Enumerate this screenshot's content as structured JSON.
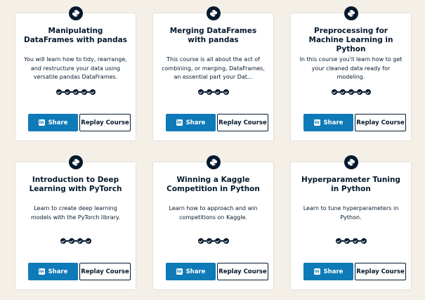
{
  "buttons": {
    "share_label": "Share",
    "replay_label": "Replay Course",
    "linkedin_glyph": "in"
  },
  "colors": {
    "background": "#f4f0e8",
    "ink": "#05192d",
    "share_blue": "#0f7ab8"
  },
  "courses": [
    {
      "title": "Manipulating DataFrames with pandas",
      "description": "You will learn how to tidy, rearrange, and restructure your data using versatile pandas DataFrames.",
      "chapters": 5
    },
    {
      "title": "Merging DataFrames with pandas",
      "description": "This course is all about the act of combining, or merging, DataFrames, an essential part your Dat...",
      "chapters": 4
    },
    {
      "title": "Preprocessing for Machine Learning in Python",
      "description": "In this course you'll learn how to get your cleaned data ready for modeling.",
      "chapters": 5
    },
    {
      "title": "Introduction to Deep Learning with PyTorch",
      "description": "Learn to create deep learning models with the PyTorch library.",
      "chapters": 4
    },
    {
      "title": "Winning a Kaggle Competition in Python",
      "description": "Learn how to approach and win competitions on Kaggle.",
      "chapters": 4
    },
    {
      "title": "Hyperparameter Tuning in Python",
      "description": "Learn to tune hyperparameters in Python.",
      "chapters": 4
    }
  ]
}
